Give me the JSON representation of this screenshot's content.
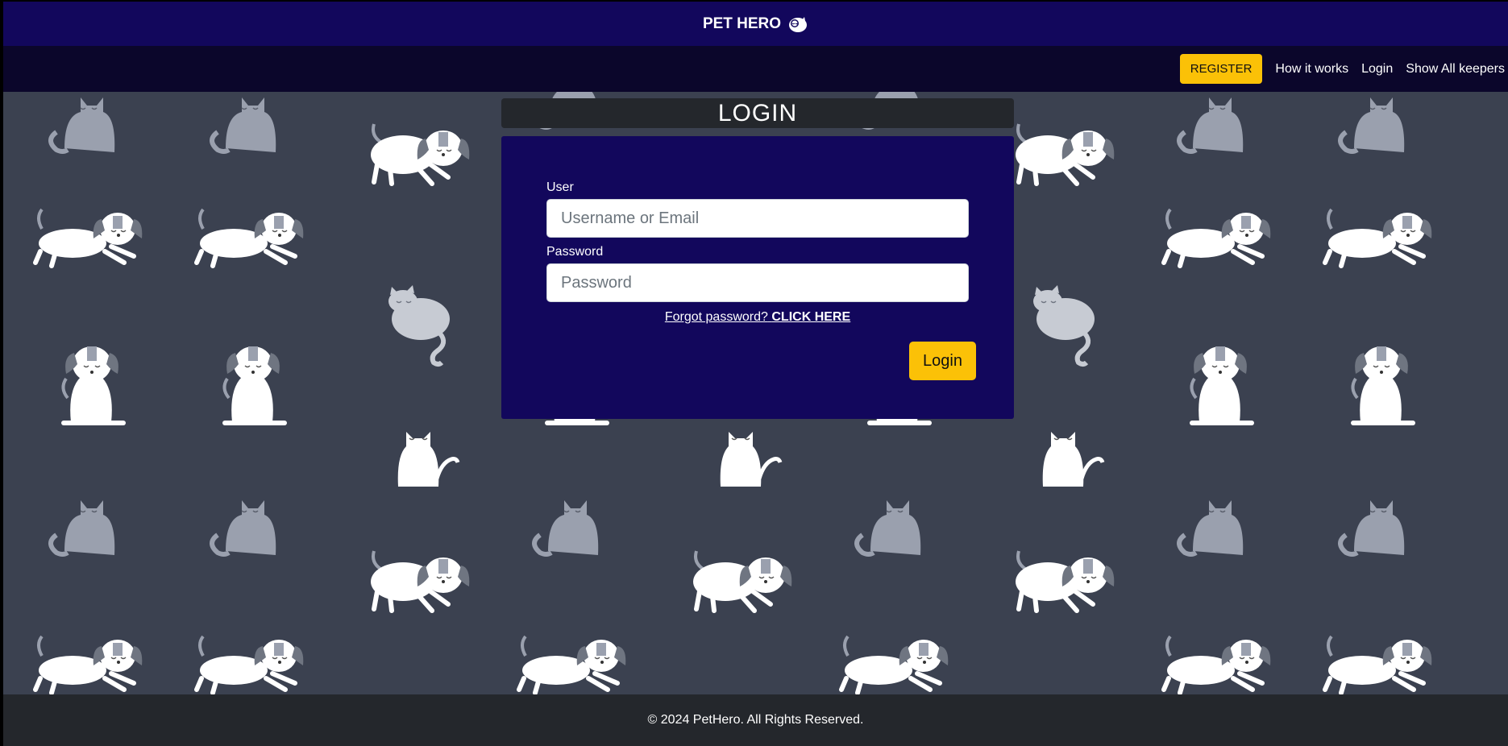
{
  "header": {
    "brand": "PET HERO",
    "brand_icon": "sleeping-pet-icon"
  },
  "nav": {
    "register": "REGISTER",
    "how_it_works": "How it works",
    "login": "Login",
    "show_all_keepers": "Show All keepers"
  },
  "login": {
    "title": "LOGIN",
    "user_label": "User",
    "user_placeholder": "Username or Email",
    "password_label": "Password",
    "password_placeholder": "Password",
    "forgot_text": "Forgot password?",
    "forgot_link": "CLICK HERE",
    "submit": "Login"
  },
  "footer": {
    "copyright": "© 2024 PetHero. All Rights Reserved."
  },
  "colors": {
    "topbar": "#12075c",
    "navbar": "#0b062b",
    "accent": "#fbc107",
    "background": "#3b4150",
    "card": "#12075c",
    "footer": "#24272c"
  }
}
